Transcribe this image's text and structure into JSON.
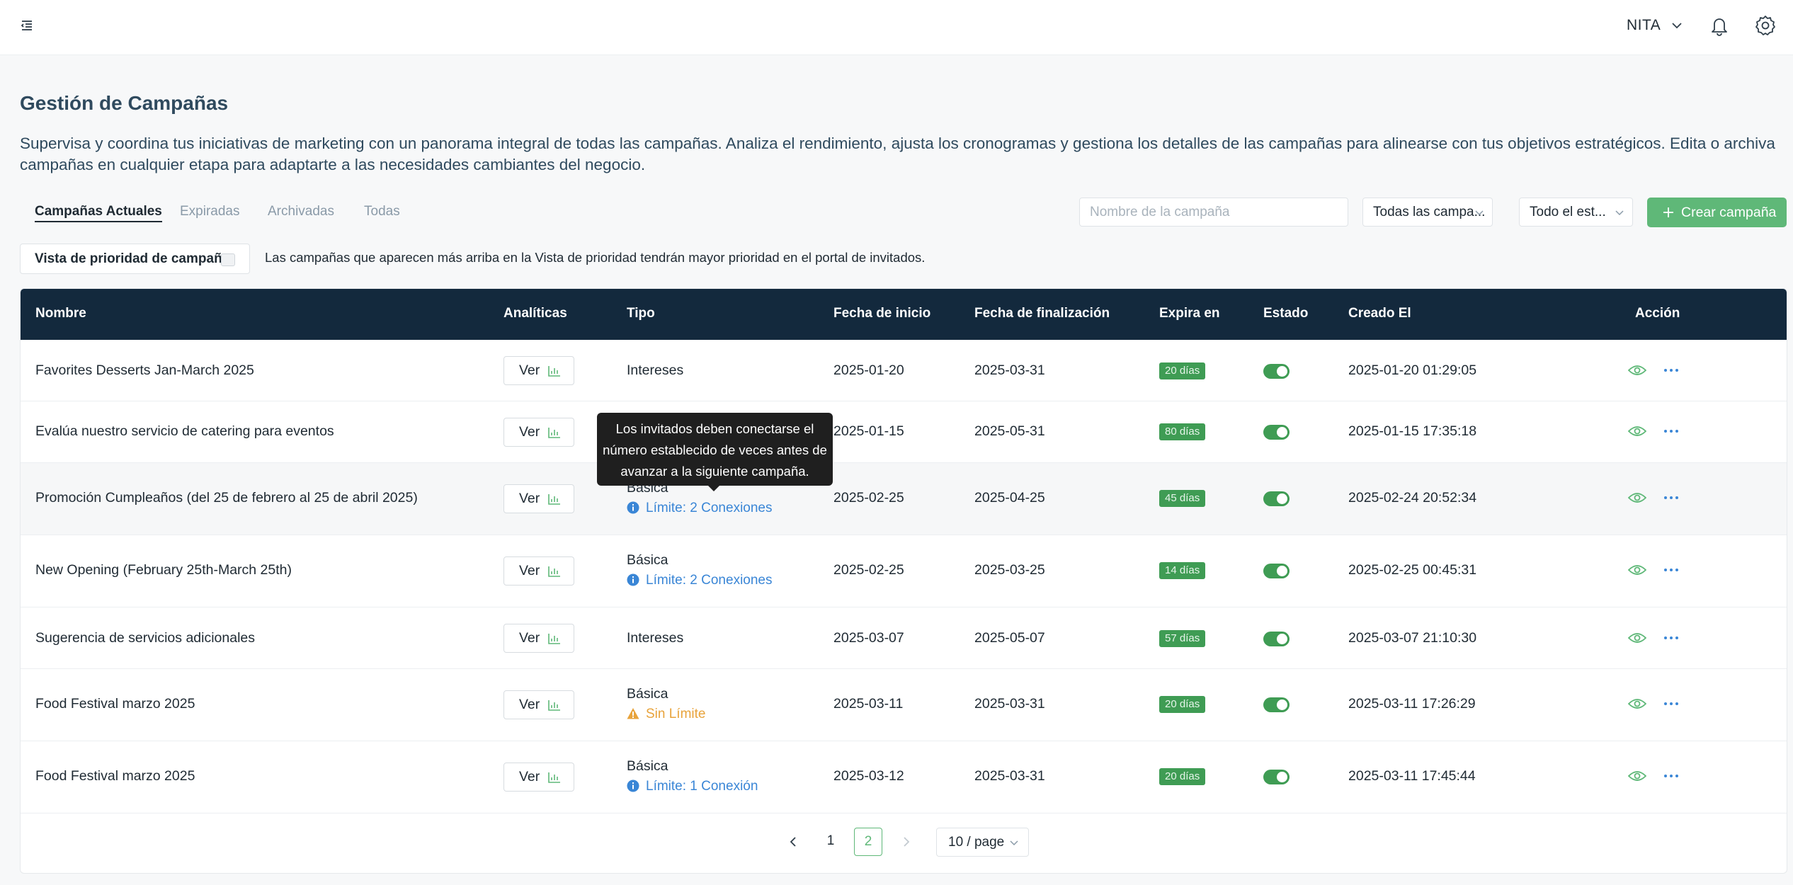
{
  "header": {
    "user_name": "NITA",
    "icons": [
      "menu-icon",
      "chevron-down-icon",
      "bell-icon",
      "gear-icon"
    ]
  },
  "page": {
    "title": "Gestión de Campañas",
    "description": "Supervisa y coordina tus iniciativas de marketing con un panorama integral de todas las campañas. Analiza el rendimiento, ajusta los cronogramas y gestiona los detalles de las campañas para alinearse con tus objetivos estratégicos. Edita o archiva campañas en cualquier etapa para adaptarte a las necesidades cambiantes del negocio."
  },
  "tabs": [
    "Campañas Actuales",
    "Expiradas",
    "Archivadas",
    "Todas"
  ],
  "active_tab": "Campañas Actuales",
  "filters": {
    "search_placeholder": "Nombre de la campaña",
    "type_filter": "Todas las campa...",
    "status_filter": "Todo el est...",
    "create_label": "Crear campaña"
  },
  "priority": {
    "label": "Vista de prioridad de campaña",
    "note": "Las campañas que aparecen más arriba en la Vista de prioridad tendrán mayor prioridad en el portal de invitados."
  },
  "table": {
    "columns": [
      "Nombre",
      "Analíticas",
      "Tipo",
      "Fecha de inicio",
      "Fecha de finalización",
      "Expira en",
      "Estado",
      "Creado El",
      "Acción"
    ],
    "view_label": "Ver",
    "rows": [
      {
        "name": "Favorites Desserts Jan-March 2025",
        "type": "Intereses",
        "limit": "",
        "start": "2025-01-20",
        "end": "2025-03-31",
        "expires": "20 días",
        "created": "2025-01-20 01:29:05"
      },
      {
        "name": "Evalúa nuestro servicio de catering para eventos",
        "type": "",
        "limit": "",
        "start": "2025-01-15",
        "end": "2025-05-31",
        "expires": "80 días",
        "created": "2025-01-15 17:35:18"
      },
      {
        "name": "Promoción Cumpleaños (del 25 de febrero al 25 de abril 2025)",
        "type": "Básica",
        "limit": "Límite: 2 Conexiones",
        "start": "2025-02-25",
        "end": "2025-04-25",
        "expires": "45 días",
        "created": "2025-02-24 20:52:34"
      },
      {
        "name": "New Opening (February 25th-March 25th)",
        "type": "Básica",
        "limit": "Límite: 2 Conexiones",
        "start": "2025-02-25",
        "end": "2025-03-25",
        "expires": "14 días",
        "created": "2025-02-25 00:45:31"
      },
      {
        "name": "Sugerencia de servicios adicionales",
        "type": "Intereses",
        "limit": "",
        "start": "2025-03-07",
        "end": "2025-05-07",
        "expires": "57 días",
        "created": "2025-03-07 21:10:30"
      },
      {
        "name": "Food Festival marzo 2025",
        "type": "Básica",
        "limit": "Sin Límite",
        "start": "2025-03-11",
        "end": "2025-03-31",
        "expires": "20 días",
        "created": "2025-03-11 17:26:29"
      },
      {
        "name": "Food Festival marzo 2025",
        "type": "Básica",
        "limit": "Límite: 1 Conexión",
        "start": "2025-03-12",
        "end": "2025-03-31",
        "expires": "20 días",
        "created": "2025-03-11 17:45:44"
      }
    ],
    "status_enabled": [
      true,
      true,
      true,
      true,
      true,
      true,
      true
    ]
  },
  "tooltip": "Los invitados deben conectarse el número establecido de veces antes de avanzar a la siguiente campaña.",
  "pagination": {
    "pages": [
      "1",
      "2"
    ],
    "current": "2",
    "page_size": "10 / page"
  },
  "colors": {
    "header_bg": "#13293d",
    "accent_green": "#5fb878",
    "badge_green": "#3f9c54",
    "link_blue": "#3a86d6",
    "warning": "#e8a33b"
  }
}
